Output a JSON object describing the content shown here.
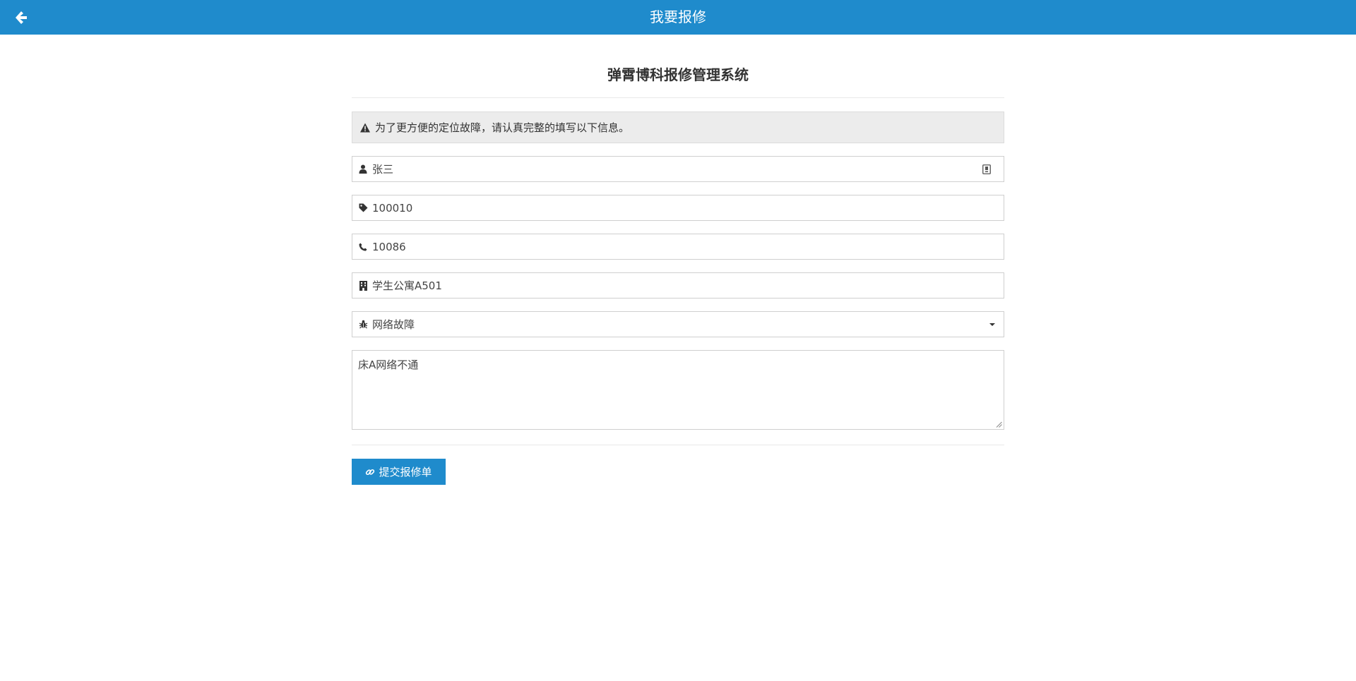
{
  "header": {
    "title": "我要报修",
    "background_color": "#1f8bcc"
  },
  "page": {
    "system_title": "弹霄博科报修管理系统"
  },
  "notice": {
    "text": "为了更方便的定位故障，请认真完整的填写以下信息。",
    "icon": "warning-icon"
  },
  "form": {
    "name": {
      "value": "张三",
      "icon": "user-icon"
    },
    "student_id": {
      "value": "100010",
      "icon": "tag-icon"
    },
    "phone": {
      "value": "10086",
      "icon": "phone-icon"
    },
    "address": {
      "value": "学生公寓A501",
      "icon": "building-icon"
    },
    "fault_type": {
      "selected": "网络故障",
      "icon": "bug-icon"
    },
    "description": {
      "value": "床A网络不通"
    }
  },
  "actions": {
    "submit_label": "提交报修单",
    "submit_icon": "link-icon"
  }
}
